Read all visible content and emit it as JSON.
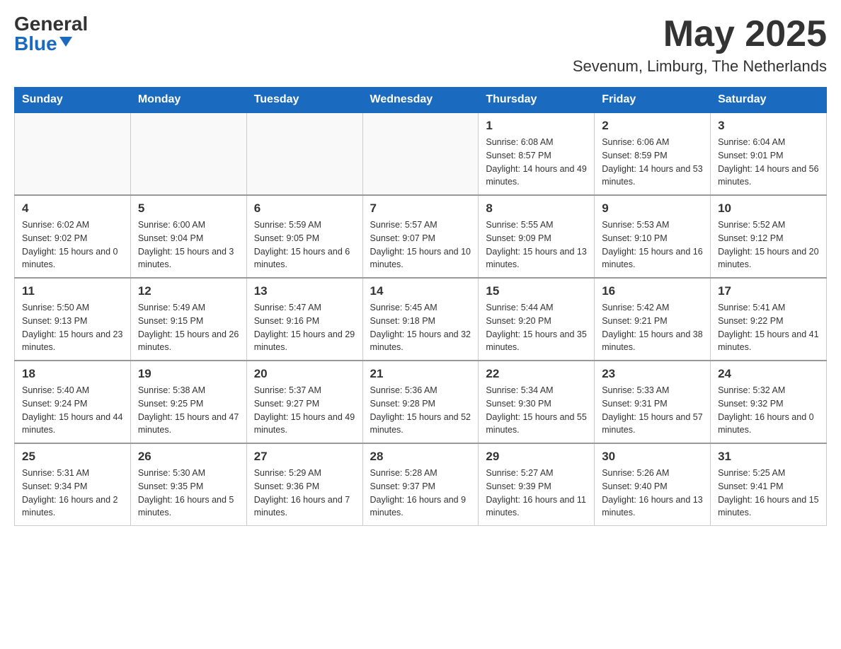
{
  "header": {
    "logo": {
      "general": "General",
      "blue": "Blue",
      "arrow": "▼"
    },
    "month_title": "May 2025",
    "location": "Sevenum, Limburg, The Netherlands"
  },
  "days_of_week": [
    "Sunday",
    "Monday",
    "Tuesday",
    "Wednesday",
    "Thursday",
    "Friday",
    "Saturday"
  ],
  "weeks": [
    {
      "days": [
        {
          "num": "",
          "info": ""
        },
        {
          "num": "",
          "info": ""
        },
        {
          "num": "",
          "info": ""
        },
        {
          "num": "",
          "info": ""
        },
        {
          "num": "1",
          "info": "Sunrise: 6:08 AM\nSunset: 8:57 PM\nDaylight: 14 hours and 49 minutes."
        },
        {
          "num": "2",
          "info": "Sunrise: 6:06 AM\nSunset: 8:59 PM\nDaylight: 14 hours and 53 minutes."
        },
        {
          "num": "3",
          "info": "Sunrise: 6:04 AM\nSunset: 9:01 PM\nDaylight: 14 hours and 56 minutes."
        }
      ]
    },
    {
      "days": [
        {
          "num": "4",
          "info": "Sunrise: 6:02 AM\nSunset: 9:02 PM\nDaylight: 15 hours and 0 minutes."
        },
        {
          "num": "5",
          "info": "Sunrise: 6:00 AM\nSunset: 9:04 PM\nDaylight: 15 hours and 3 minutes."
        },
        {
          "num": "6",
          "info": "Sunrise: 5:59 AM\nSunset: 9:05 PM\nDaylight: 15 hours and 6 minutes."
        },
        {
          "num": "7",
          "info": "Sunrise: 5:57 AM\nSunset: 9:07 PM\nDaylight: 15 hours and 10 minutes."
        },
        {
          "num": "8",
          "info": "Sunrise: 5:55 AM\nSunset: 9:09 PM\nDaylight: 15 hours and 13 minutes."
        },
        {
          "num": "9",
          "info": "Sunrise: 5:53 AM\nSunset: 9:10 PM\nDaylight: 15 hours and 16 minutes."
        },
        {
          "num": "10",
          "info": "Sunrise: 5:52 AM\nSunset: 9:12 PM\nDaylight: 15 hours and 20 minutes."
        }
      ]
    },
    {
      "days": [
        {
          "num": "11",
          "info": "Sunrise: 5:50 AM\nSunset: 9:13 PM\nDaylight: 15 hours and 23 minutes."
        },
        {
          "num": "12",
          "info": "Sunrise: 5:49 AM\nSunset: 9:15 PM\nDaylight: 15 hours and 26 minutes."
        },
        {
          "num": "13",
          "info": "Sunrise: 5:47 AM\nSunset: 9:16 PM\nDaylight: 15 hours and 29 minutes."
        },
        {
          "num": "14",
          "info": "Sunrise: 5:45 AM\nSunset: 9:18 PM\nDaylight: 15 hours and 32 minutes."
        },
        {
          "num": "15",
          "info": "Sunrise: 5:44 AM\nSunset: 9:20 PM\nDaylight: 15 hours and 35 minutes."
        },
        {
          "num": "16",
          "info": "Sunrise: 5:42 AM\nSunset: 9:21 PM\nDaylight: 15 hours and 38 minutes."
        },
        {
          "num": "17",
          "info": "Sunrise: 5:41 AM\nSunset: 9:22 PM\nDaylight: 15 hours and 41 minutes."
        }
      ]
    },
    {
      "days": [
        {
          "num": "18",
          "info": "Sunrise: 5:40 AM\nSunset: 9:24 PM\nDaylight: 15 hours and 44 minutes."
        },
        {
          "num": "19",
          "info": "Sunrise: 5:38 AM\nSunset: 9:25 PM\nDaylight: 15 hours and 47 minutes."
        },
        {
          "num": "20",
          "info": "Sunrise: 5:37 AM\nSunset: 9:27 PM\nDaylight: 15 hours and 49 minutes."
        },
        {
          "num": "21",
          "info": "Sunrise: 5:36 AM\nSunset: 9:28 PM\nDaylight: 15 hours and 52 minutes."
        },
        {
          "num": "22",
          "info": "Sunrise: 5:34 AM\nSunset: 9:30 PM\nDaylight: 15 hours and 55 minutes."
        },
        {
          "num": "23",
          "info": "Sunrise: 5:33 AM\nSunset: 9:31 PM\nDaylight: 15 hours and 57 minutes."
        },
        {
          "num": "24",
          "info": "Sunrise: 5:32 AM\nSunset: 9:32 PM\nDaylight: 16 hours and 0 minutes."
        }
      ]
    },
    {
      "days": [
        {
          "num": "25",
          "info": "Sunrise: 5:31 AM\nSunset: 9:34 PM\nDaylight: 16 hours and 2 minutes."
        },
        {
          "num": "26",
          "info": "Sunrise: 5:30 AM\nSunset: 9:35 PM\nDaylight: 16 hours and 5 minutes."
        },
        {
          "num": "27",
          "info": "Sunrise: 5:29 AM\nSunset: 9:36 PM\nDaylight: 16 hours and 7 minutes."
        },
        {
          "num": "28",
          "info": "Sunrise: 5:28 AM\nSunset: 9:37 PM\nDaylight: 16 hours and 9 minutes."
        },
        {
          "num": "29",
          "info": "Sunrise: 5:27 AM\nSunset: 9:39 PM\nDaylight: 16 hours and 11 minutes."
        },
        {
          "num": "30",
          "info": "Sunrise: 5:26 AM\nSunset: 9:40 PM\nDaylight: 16 hours and 13 minutes."
        },
        {
          "num": "31",
          "info": "Sunrise: 5:25 AM\nSunset: 9:41 PM\nDaylight: 16 hours and 15 minutes."
        }
      ]
    }
  ]
}
